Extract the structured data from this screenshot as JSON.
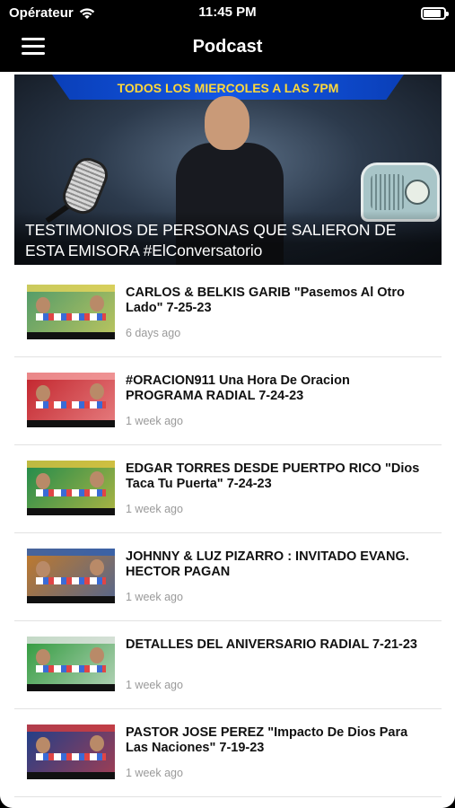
{
  "status_bar": {
    "carrier": "Opérateur",
    "time": "11:45 PM",
    "battery_level": 0.85
  },
  "nav": {
    "title": "Podcast",
    "menu_icon": "hamburger-menu-icon"
  },
  "featured": {
    "banner_text": "TODOS LOS MIERCOLES A LAS 7PM",
    "title": "TESTIMONIOS DE PERSONAS QUE SALIERON DE ESTA EMISORA #ElConversatorio"
  },
  "episodes": [
    {
      "title": "CARLOS & BELKIS GARIB \"Pasemos Al Otro Lado\" 7-25-23",
      "date": "6 days ago",
      "thumb_color": "#4f9a6a",
      "thumb_accent": "#e8d65a"
    },
    {
      "title": "#ORACION911 Una Hora De Oracion PROGRAMA RADIAL 7-24-23",
      "date": "1 week ago",
      "thumb_color": "#c2242c",
      "thumb_accent": "#f4a0a0"
    },
    {
      "title": "EDGAR TORRES DESDE PUERTPO RICO \"Dios Taca Tu Puerta\" 7-24-23",
      "date": "1 week ago",
      "thumb_color": "#1f8a4c",
      "thumb_accent": "#e5c640"
    },
    {
      "title": "JOHNNY & LUZ PIZARRO : INVITADO EVANG. HECTOR PAGAN",
      "date": "1 week ago",
      "thumb_color": "#c27a2a",
      "thumb_accent": "#2a5fb5"
    },
    {
      "title": "DETALLES DEL ANIVERSARIO RADIAL 7-21-23",
      "date": "1 week ago",
      "thumb_color": "#2f9a3c",
      "thumb_accent": "#e9e9e9"
    },
    {
      "title": "PASTOR JOSE PEREZ \"Impacto De Dios Para Las Naciones\" 7-19-23",
      "date": "1 week ago",
      "thumb_color": "#1d3f8a",
      "thumb_accent": "#d63d3d"
    }
  ]
}
